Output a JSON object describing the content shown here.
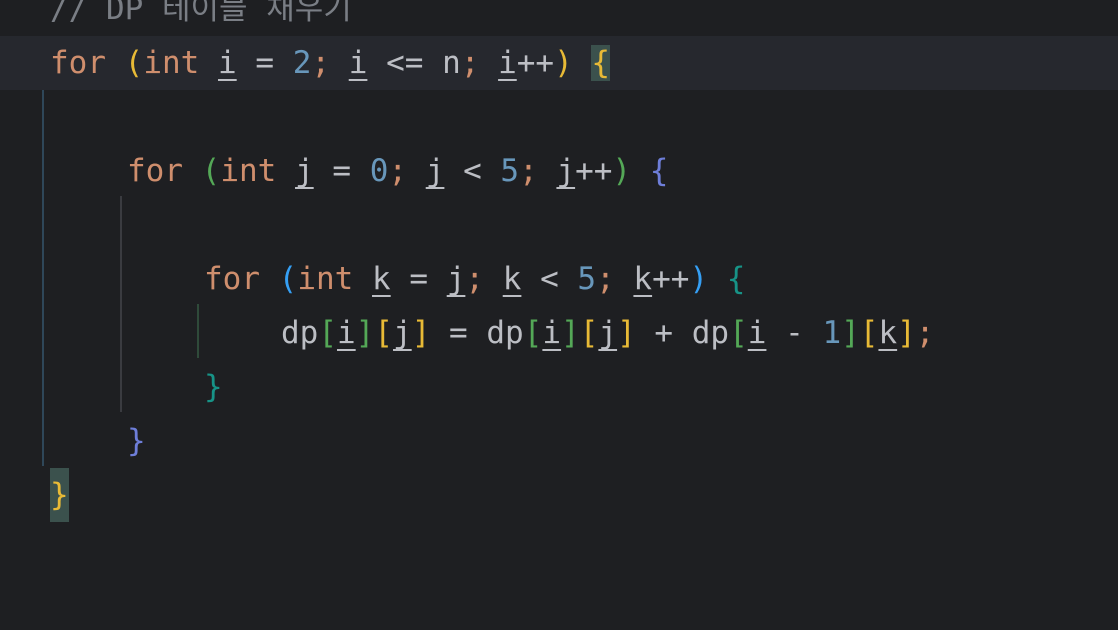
{
  "editor": {
    "comment": "// DP 테이블 채우기",
    "keywords": {
      "for": "for",
      "int": "int"
    },
    "vars": {
      "i": "i",
      "j": "j",
      "k": "k",
      "n": "n",
      "dp": "dp"
    },
    "nums": {
      "zero": "0",
      "one": "1",
      "two": "2",
      "five": "5"
    },
    "ops": {
      "assign": "=",
      "lte": "<=",
      "lt": "<",
      "inc": "++",
      "plus": "+",
      "minus": "-",
      "semi": ";"
    },
    "brackets": {
      "lparen": "(",
      "rparen": ")",
      "lbrace": "{",
      "rbrace": "}",
      "lbrack": "[",
      "rbrack": "]"
    }
  },
  "colors": {
    "background": "#1e1f22",
    "current_line": "#26282e",
    "keyword": "#cf8e6d",
    "number": "#6897bb",
    "identifier": "#bcbec4",
    "comment": "#7a7e85",
    "bracket_gold": "#e8ba36",
    "bracket_green": "#54a857",
    "bracket_blue": "#359ff4",
    "bracket_violet": "#6e7ed9",
    "bracket_teal": "#179387",
    "brace_match": "#3b514d"
  }
}
